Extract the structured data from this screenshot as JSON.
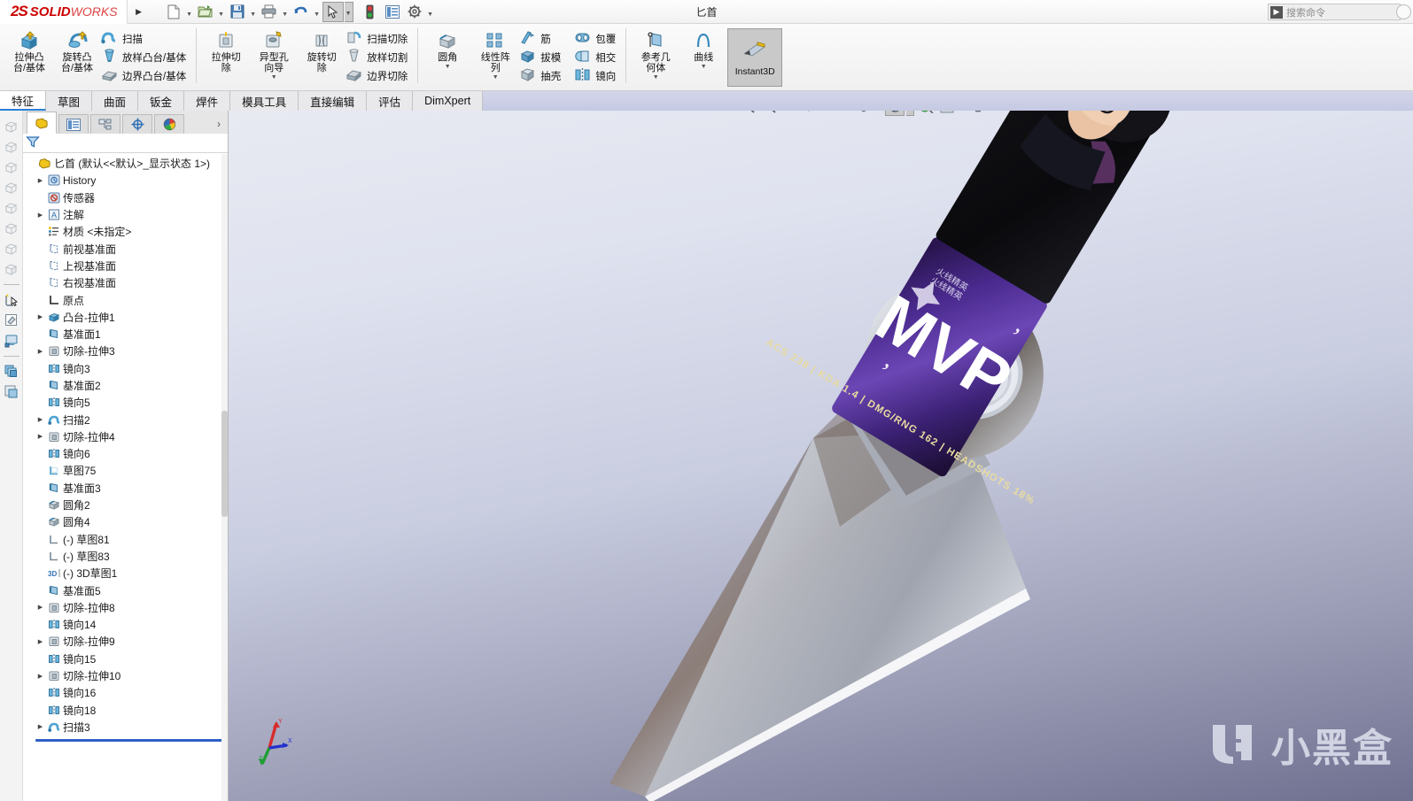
{
  "app": {
    "brand_ds": "2S",
    "brand_solid": "SOLID",
    "brand_works": "WORKS",
    "doc_title": "匕首",
    "accent_blue": "#2b7fd4",
    "brand_red": "#cc0000"
  },
  "search": {
    "placeholder": "搜索命令",
    "icon": "search-command-icon"
  },
  "quick_access": [
    {
      "name": "new-document",
      "icon": "new-file-icon",
      "has_dropdown": true
    },
    {
      "name": "open-document",
      "icon": "open-folder-icon",
      "has_dropdown": true
    },
    {
      "name": "save-document",
      "icon": "floppy-save-icon",
      "has_dropdown": true
    },
    {
      "name": "print-document",
      "icon": "printer-icon",
      "has_dropdown": true
    },
    {
      "name": "undo",
      "icon": "undo-arrow-icon",
      "has_dropdown": true
    },
    {
      "name": "select",
      "icon": "cursor-arrow-icon",
      "has_dropdown": true,
      "selected": true
    },
    {
      "name": "rebuild",
      "icon": "traffic-light-icon",
      "has_dropdown": false
    },
    {
      "name": "options-list",
      "icon": "list-panel-icon",
      "has_dropdown": false
    },
    {
      "name": "settings",
      "icon": "gear-icon",
      "has_dropdown": true
    }
  ],
  "ribbon": {
    "group1_big": [
      {
        "label": "拉伸凸\n台/基体",
        "line1": "拉伸凸",
        "line2": "台/基体",
        "icon": "extrude-boss-icon"
      },
      {
        "line1": "旋转凸",
        "line2": "台/基体",
        "icon": "revolve-boss-icon"
      }
    ],
    "group1_small": [
      {
        "label": "扫描",
        "icon": "sweep-icon"
      },
      {
        "label": "放样凸台/基体",
        "icon": "loft-boss-icon"
      },
      {
        "label": "边界凸台/基体",
        "icon": "boundary-boss-icon"
      }
    ],
    "group2_big": [
      {
        "line1": "拉伸切",
        "line2": "除",
        "icon": "extrude-cut-icon"
      },
      {
        "line1": "异型孔",
        "line2": "向导",
        "icon": "hole-wizard-icon",
        "has_dropdown": true
      },
      {
        "line1": "旋转切",
        "line2": "除",
        "icon": "revolve-cut-icon"
      }
    ],
    "group2_small": [
      {
        "label": "扫描切除",
        "icon": "sweep-cut-icon"
      },
      {
        "label": "放样切割",
        "icon": "loft-cut-icon"
      },
      {
        "label": "边界切除",
        "icon": "boundary-cut-icon"
      }
    ],
    "group3_big": [
      {
        "line1": "圆角",
        "line2": "",
        "icon": "fillet-icon",
        "has_dropdown": true
      },
      {
        "line1": "线性阵",
        "line2": "列",
        "icon": "linear-pattern-icon",
        "has_dropdown": true
      }
    ],
    "group3_small": [
      {
        "label": "筋",
        "icon": "rib-icon"
      },
      {
        "label": "拔模",
        "icon": "draft-icon"
      },
      {
        "label": "抽壳",
        "icon": "shell-icon"
      }
    ],
    "group4_small": [
      {
        "label": "包覆",
        "icon": "wrap-icon"
      },
      {
        "label": "相交",
        "icon": "intersect-icon"
      },
      {
        "label": "镜向",
        "icon": "mirror-icon"
      }
    ],
    "group5_big": [
      {
        "line1": "参考几",
        "line2": "何体",
        "icon": "reference-geometry-icon",
        "has_dropdown": true
      },
      {
        "line1": "曲线",
        "line2": "",
        "icon": "curves-icon",
        "has_dropdown": true
      }
    ],
    "instant3d": {
      "label": "Instant3D",
      "icon": "instant3d-icon",
      "active": true
    }
  },
  "tabs": [
    {
      "label": "特征",
      "active": true
    },
    {
      "label": "草图",
      "active": false
    },
    {
      "label": "曲面",
      "active": false
    },
    {
      "label": "钣金",
      "active": false
    },
    {
      "label": "焊件",
      "active": false
    },
    {
      "label": "模具工具",
      "active": false
    },
    {
      "label": "直接编辑",
      "active": false
    },
    {
      "label": "评估",
      "active": false
    },
    {
      "label": "DimXpert",
      "active": false
    }
  ],
  "left_rail": [
    {
      "name": "view-orientation-1",
      "icon": "cube-icon"
    },
    {
      "name": "view-orientation-2",
      "icon": "cube-icon"
    },
    {
      "name": "view-orientation-3",
      "icon": "cube-icon"
    },
    {
      "name": "view-orientation-4",
      "icon": "cube-icon"
    },
    {
      "name": "view-orientation-5",
      "icon": "cube-icon"
    },
    {
      "name": "view-orientation-6",
      "icon": "cube-icon"
    },
    {
      "name": "view-orientation-7",
      "icon": "cube-icon"
    },
    {
      "name": "section-view",
      "icon": "section-cube-icon"
    },
    {
      "name": "magnified-select",
      "icon": "magnify-select-icon"
    },
    {
      "name": "edit-appearance",
      "icon": "edit-appearance-icon"
    },
    {
      "name": "display-pane",
      "icon": "display-pane-icon"
    },
    {
      "name": "copy-stack-1",
      "icon": "copy-stack-icon"
    },
    {
      "name": "copy-stack-2",
      "icon": "copy-stack-icon"
    }
  ],
  "tree_panel": {
    "tabs": [
      {
        "name": "feature-manager-tab",
        "icon": "feature-tree-icon",
        "active": true
      },
      {
        "name": "property-manager-tab",
        "icon": "property-list-icon",
        "active": false
      },
      {
        "name": "configuration-manager-tab",
        "icon": "configuration-icon",
        "active": false
      },
      {
        "name": "dimxpert-manager-tab",
        "icon": "crosshair-icon",
        "active": false
      },
      {
        "name": "display-manager-tab",
        "icon": "color-wheel-icon",
        "active": false
      }
    ],
    "chevron": "›",
    "filter_placeholder": "",
    "filter_icon": "filter-funnel-icon",
    "root": {
      "label": "匕首  (默认<<默认>_显示状态 1>)",
      "icon": "part-document-icon"
    },
    "items": [
      {
        "label": "History",
        "icon": "history-icon",
        "expandable": true,
        "indent": 1
      },
      {
        "label": "传感器",
        "icon": "sensor-icon",
        "expandable": false,
        "indent": 1
      },
      {
        "label": "注解",
        "icon": "annotations-icon",
        "expandable": true,
        "indent": 1
      },
      {
        "label": "材质 <未指定>",
        "icon": "material-icon",
        "expandable": false,
        "indent": 1
      },
      {
        "label": "前视基准面",
        "icon": "plane-icon",
        "expandable": false,
        "indent": 1
      },
      {
        "label": "上视基准面",
        "icon": "plane-icon",
        "expandable": false,
        "indent": 1
      },
      {
        "label": "右视基准面",
        "icon": "plane-icon",
        "expandable": false,
        "indent": 1
      },
      {
        "label": "原点",
        "icon": "origin-icon",
        "expandable": false,
        "indent": 1
      },
      {
        "label": "凸台-拉伸1",
        "icon": "boss-extrude-icon",
        "expandable": true,
        "indent": 1
      },
      {
        "label": "基准面1",
        "icon": "plane-blue-icon",
        "expandable": false,
        "indent": 1
      },
      {
        "label": "切除-拉伸3",
        "icon": "cut-extrude-icon",
        "expandable": true,
        "indent": 1
      },
      {
        "label": "镜向3",
        "icon": "mirror-feature-icon",
        "expandable": false,
        "indent": 1
      },
      {
        "label": "基准面2",
        "icon": "plane-blue-icon",
        "expandable": false,
        "indent": 1
      },
      {
        "label": "镜向5",
        "icon": "mirror-feature-icon",
        "expandable": false,
        "indent": 1
      },
      {
        "label": "扫描2",
        "icon": "sweep-feature-icon",
        "expandable": true,
        "indent": 1
      },
      {
        "label": "切除-拉伸4",
        "icon": "cut-extrude-icon",
        "expandable": true,
        "indent": 1
      },
      {
        "label": "镜向6",
        "icon": "mirror-feature-icon",
        "expandable": false,
        "indent": 1
      },
      {
        "label": "草图75",
        "icon": "sketch-icon",
        "expandable": false,
        "indent": 1
      },
      {
        "label": "基准面3",
        "icon": "plane-blue-icon",
        "expandable": false,
        "indent": 1
      },
      {
        "label": "圆角2",
        "icon": "fillet-feature-icon",
        "expandable": false,
        "indent": 1
      },
      {
        "label": "圆角4",
        "icon": "fillet-feature-icon",
        "expandable": false,
        "indent": 1
      },
      {
        "label": "(-) 草图81",
        "icon": "sketch-icon",
        "expandable": false,
        "indent": 1
      },
      {
        "label": "(-) 草图83",
        "icon": "sketch-icon",
        "expandable": false,
        "indent": 1
      },
      {
        "label": "(-) 3D草图1",
        "icon": "sketch-3d-icon",
        "expandable": false,
        "indent": 1
      },
      {
        "label": "基准面5",
        "icon": "plane-blue-icon",
        "expandable": false,
        "indent": 1
      },
      {
        "label": "切除-拉伸8",
        "icon": "cut-extrude-icon",
        "expandable": true,
        "indent": 1
      },
      {
        "label": "镜向14",
        "icon": "mirror-feature-icon",
        "expandable": false,
        "indent": 1
      },
      {
        "label": "切除-拉伸9",
        "icon": "cut-extrude-icon",
        "expandable": true,
        "indent": 1
      },
      {
        "label": "镜向15",
        "icon": "mirror-feature-icon",
        "expandable": false,
        "indent": 1
      },
      {
        "label": "切除-拉伸10",
        "icon": "cut-extrude-icon",
        "expandable": true,
        "indent": 1
      },
      {
        "label": "镜向16",
        "icon": "mirror-feature-icon",
        "expandable": false,
        "indent": 1
      },
      {
        "label": "镜向18",
        "icon": "mirror-feature-icon",
        "expandable": false,
        "indent": 1
      },
      {
        "label": "扫描3",
        "icon": "sweep-feature-icon",
        "expandable": true,
        "indent": 1
      }
    ],
    "rollback_bar": true
  },
  "view_toolbar": [
    {
      "name": "zoom-to-fit",
      "icon": "zoom-fit-icon",
      "has_dropdown": false
    },
    {
      "name": "zoom-to-area",
      "icon": "zoom-area-icon",
      "has_dropdown": false
    },
    {
      "name": "previous-view",
      "icon": "previous-view-icon",
      "has_dropdown": false
    },
    {
      "name": "section-view",
      "icon": "section-view-icon",
      "has_dropdown": false
    },
    {
      "name": "view-orientation",
      "icon": "view-orientation-icon",
      "has_dropdown": true
    },
    {
      "name": "display-style",
      "icon": "display-style-icon",
      "has_dropdown": true
    },
    {
      "name": "hide-show-items",
      "icon": "eye-icon",
      "has_dropdown": true,
      "selected": true
    },
    {
      "name": "edit-appearance",
      "icon": "appearance-palette-icon",
      "has_dropdown": false
    },
    {
      "name": "apply-scene",
      "icon": "scene-sphere-icon",
      "has_dropdown": true
    },
    {
      "name": "view-settings",
      "icon": "monitor-icon",
      "has_dropdown": false
    }
  ],
  "viewport": {
    "model_name": "dagger-3d-model",
    "triad": {
      "name": "axis-triad",
      "axes": [
        "X",
        "Y",
        "Z"
      ],
      "colors": {
        "x": "#d92b2b",
        "y": "#1f9e33",
        "z": "#2430cc"
      }
    },
    "skin_decal": {
      "title": "MVP",
      "stats_line": "ACS  238  |  KDA  1.4  |  DMG/RNG  162  |  HEADSHOTS  18%",
      "stats": [
        {
          "label": "ACS",
          "value": "238"
        },
        {
          "label": "KDA",
          "value": "1.4"
        },
        {
          "label": "DMG/RNG",
          "value": "162"
        },
        {
          "label": "HEADSHOTS",
          "value": "18%"
        }
      ],
      "cn_text": "火线精英\n火线精英",
      "accent_purple": "#5b3a9e"
    },
    "watermark": {
      "text": "小黑盒",
      "icon": "xiaoheihe-logo-icon"
    }
  }
}
